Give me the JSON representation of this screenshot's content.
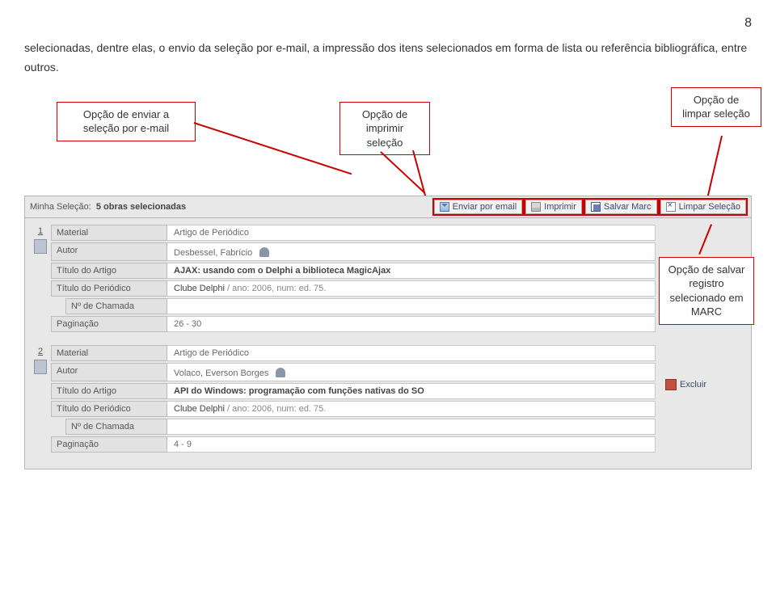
{
  "page_number": "8",
  "intro": "selecionadas, dentre elas, o envio da seleção por e-mail, a impressão dos itens selecionados em forma de lista ou referência bibliográfica, entre outros.",
  "callouts": {
    "email": "Opção de enviar a seleção por e-mail",
    "print": "Opção de imprimir seleção",
    "clear": "Opção de limpar seleção",
    "marc": "Opção de salvar registro selecionado em MARC"
  },
  "toolbar": {
    "title_label": "Minha Seleção:",
    "title_count": "5 obras selecionadas",
    "email": "Enviar por email",
    "print": "Imprimir",
    "save": "Salvar Marc",
    "clear": "Limpar Seleção"
  },
  "labels": {
    "material": "Material",
    "autor": "Autor",
    "titulo_artigo": "Título do Artigo",
    "titulo_periodico": "Título do Periódico",
    "num_chamada": "Nº de Chamada",
    "paginacao": "Paginação",
    "excluir": "Excluir"
  },
  "records": [
    {
      "num": "1",
      "material": "Artigo de Periódico",
      "autor": "Desbessel, Fabrício",
      "titulo_artigo": "AJAX: usando com o Delphi a biblioteca MagicAjax",
      "periodico_pre": "Clube Delphi",
      "periodico_rest": " / ano: 2006, num: ed. 75.",
      "num_chamada": "",
      "paginacao": "26 - 30"
    },
    {
      "num": "2",
      "material": "Artigo de Periódico",
      "autor": "Volaco, Everson Borges",
      "titulo_artigo": "API do Windows: programação com funções nativas do SO",
      "periodico_pre": "Clube Delphi",
      "periodico_rest": " / ano: 2006, num: ed. 75.",
      "num_chamada": "",
      "paginacao": "4 - 9"
    }
  ]
}
